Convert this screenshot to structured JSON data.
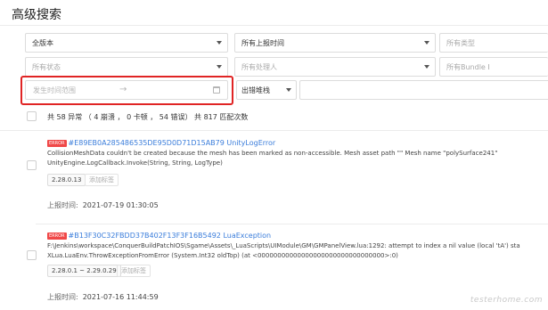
{
  "page": {
    "title": "高级搜索"
  },
  "filters": {
    "version": {
      "value": "全版本"
    },
    "report_time": {
      "value": "所有上报时间"
    },
    "type": {
      "placeholder": "所有类型"
    },
    "status": {
      "placeholder": "所有状态"
    },
    "handler": {
      "placeholder": "所有处理人"
    },
    "bundle": {
      "placeholder": "所有Bundle I"
    },
    "date_range": {
      "placeholder": "发生时间范围",
      "separator": "→"
    },
    "stack": {
      "value": "出错堆栈"
    }
  },
  "summary": {
    "text": "共 58 异常 （ 4 崩溃 ， 0 卡顿 ， 54 错误）   共 817 匹配次数"
  },
  "issues": [
    {
      "badge": "ERROR",
      "id_title": "#E89EB0A285486535DE95D0D71D15AB79 UnityLogError",
      "desc1": "CollisionMeshData couldn't be created because the mesh has been marked as non-accessible. Mesh asset path \"\" Mesh name \"polySurface241\"",
      "desc2": "UnityEngine.LogCallback.Invoke(String, String, LogType)",
      "version": "2.28.0.13",
      "add_tag": "添加标签",
      "time_label": "上报时间:",
      "time": "2021-07-19 01:30:05"
    },
    {
      "badge": "ERROR",
      "id_title": "#B13F30C32FBDD37B402F13F3F16B5492 LuaException",
      "desc1": "F:\\Jenkins\\workspace\\ConquerBuildPatchIOS\\Sgame\\Assets\\_LuaScripts\\UIModule\\GM\\GMPanelView.lua:1292: attempt to index a nil value (local 'tA') sta",
      "desc2": "XLua.LuaEnv.ThrowExceptionFromError (System.Int32 oldTop) (at <00000000000000000000000000000000>:0)",
      "version": "2.28.0.1 ~ 2.29.0.29",
      "add_tag": "添加标签",
      "time_label": "上报时间:",
      "time": "2021-07-16 11:44:59"
    }
  ],
  "watermark": "testerhome.com"
}
